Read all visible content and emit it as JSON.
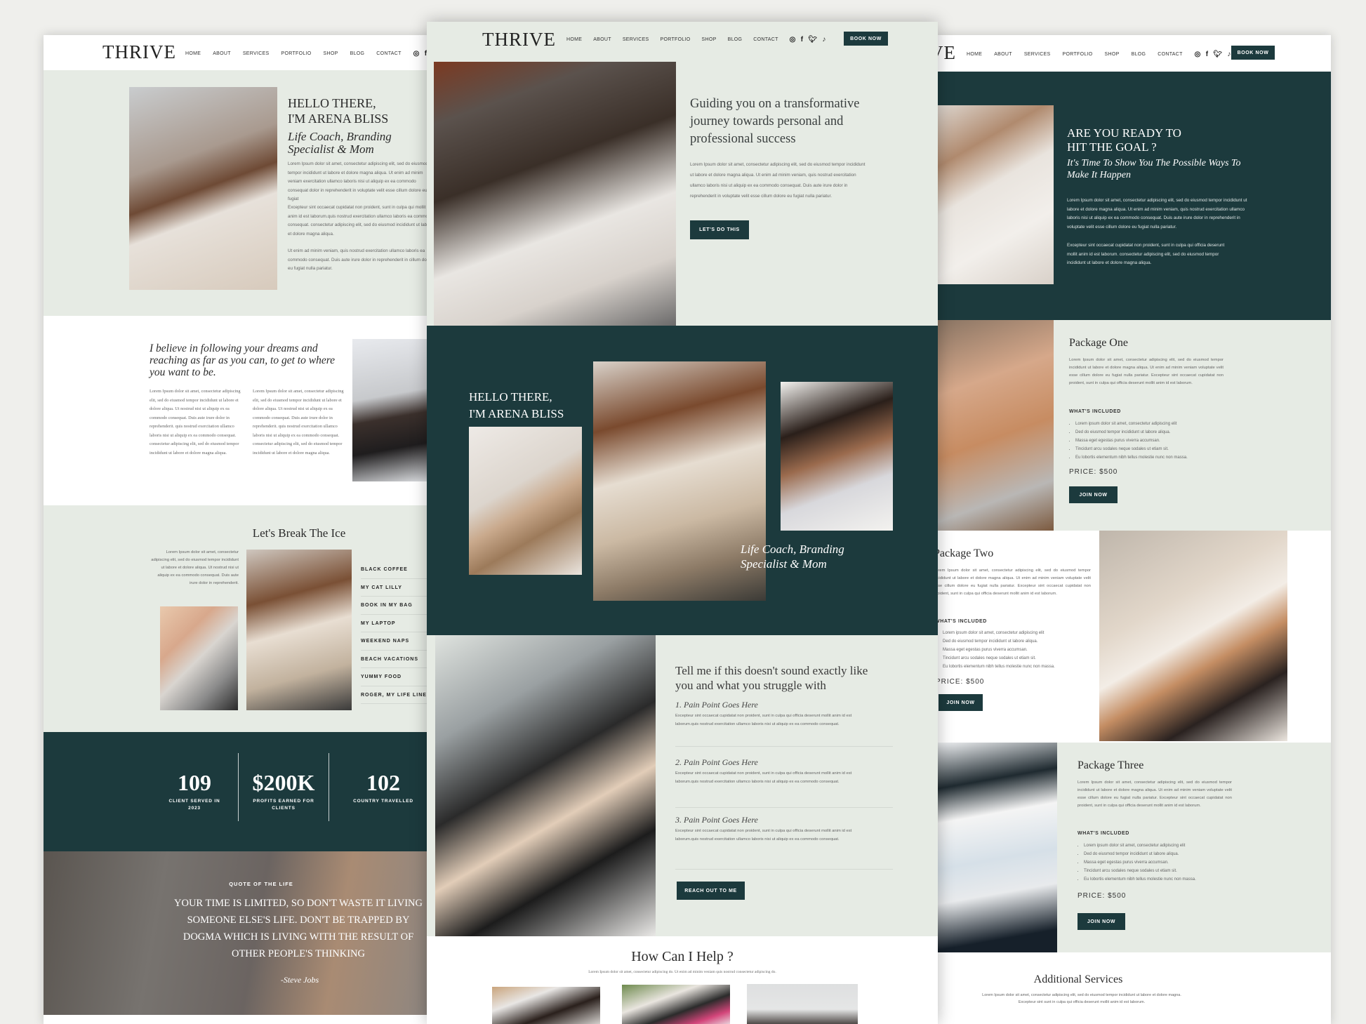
{
  "brand": {
    "logo": "THRIVE",
    "accent": "#1c3a3d",
    "sage": "#e6ebe4"
  },
  "nav": {
    "items": [
      "HOME",
      "ABOUT",
      "SERVICES",
      "PORTFOLIO",
      "SHOP",
      "BLOG",
      "CONTACT"
    ],
    "book_now": "BOOK NOW",
    "icons": [
      "instagram-icon",
      "facebook-icon",
      "twitter-icon",
      "tiktok-icon"
    ]
  },
  "left": {
    "hero": {
      "title1": "HELLO THERE,",
      "title2": "I'M ARENA BLISS",
      "subtitle": "Life Coach, Branding Specialist & Mom",
      "p1": "Lorem Ipsum dolor sit amet, consectetur adipiscing elit, sed do eiusmod tempor incididunt ut labore et dolore magna aliqua. Ut enim ad minim veniam exercitation ullamco laboris nisi ut aliquip ex ea commodo consequat dolor in reprehenderit in voluptate velit esse cillum dolore eu fugiat",
      "p2": "Excepteur sint occaecat cupidatat non proident, sunt in culpa qui mollit anim id est laborum.quis nostrud exercitation ullamco laboris ea commodo consequat. consectetur adipiscing elit, sed do eiusmod incididunt ut labore et dolore magna aliqua.",
      "p3": "Ut enim ad minim veniam, quis nostrud exercitation ullamco laboris ea commodo consequat. Duis aute irure dolor in reprehenderit in cillum dolore eu fugiat nulla pariatur."
    },
    "belief": {
      "quote": "I believe in following your dreams and reaching as far as you can, to get to where you want to be.",
      "col1": "Lorem Ipsum dolor sit amet, consectetur adipiscing elit, sed do eiusmod tempor incididunt ut labore et dolore aliqua. Ut nostrud nisi ut aliquip ex ea commodo consequat. Duis aute irure dolor in reprehenderit. quis nostrud exercitation ullamco laboris nisi ut aliquip ex ea commodo consequat. consectetur adipiscing elit, sed do eiusmod tempor incididunt ut labore et dolore magna aliqua.",
      "col2": "Lorem Ipsum dolor sit amet, consectetur adipiscing elit, sed do eiusmod tempor incididunt ut labore et dolore aliqua. Ut nostrud nisi ut aliquip ex ea commodo consequat. Duis aute irure dolor in reprehenderit. quis nostrud exercitation ullamco laboris nisi ut aliquip ex ea commodo consequat. consectetur adipiscing elit, sed do eiusmod tempor incididunt ut labore et dolore magna aliqua."
    },
    "ice": {
      "title": "Let's Break The Ice",
      "text": "Lorem Ipsum dolor sit amet, consectetur adipiscing elit, sed do eiusmod tempor incididunt ut labore et dolore aliqua. Ut nostrud nisi ut aliquip ex ea commodo consequat. Duis aute irure dolor in reprehenderit.",
      "items": [
        "BLACK COFFEE",
        "MY CAT LILLY",
        "BOOK IN MY BAG",
        "MY LAPTOP",
        "WEEKEND NAPS",
        "BEACH VACATIONS",
        "YUMMY FOOD",
        "ROGER, MY LIFE LINE"
      ]
    },
    "stats": [
      {
        "value": "109",
        "label": "CLIENT SERVED IN 2023"
      },
      {
        "value": "$200K",
        "label": "PROFITS EARNED FOR CLIENTS"
      },
      {
        "value": "102",
        "label": "COUNTRY TRAVELLED"
      }
    ],
    "quote": {
      "kicker": "QUOTE OF THE LIFE",
      "text": "YOUR TIME IS LIMITED, SO DON'T WASTE IT LIVING SOMEONE ELSE'S LIFE. DON'T BE TRAPPED BY DOGMA WHICH IS LIVING WITH THE RESULT OF OTHER PEOPLE'S THINKING",
      "author": "-Steve Jobs"
    }
  },
  "middle": {
    "hero": {
      "title": "Guiding you on a transformative journey towards personal and professional success",
      "text": "Lorem Ipsum dolor sit amet, consectetur adipiscing elit, sed do eiusmod tempor incididunt ut labore et dolore magna aliqua. Ut enim ad minim veniam, quis nostrud exercitation ullamco laboris nisi ut aliquip ex ea commodo consequat. Duis aute irure dolor in reprehenderit in voluptate velit esse cillum dolore eu fugiat nulla pariatur.",
      "button": "LET'S DO THIS"
    },
    "intro": {
      "title1": "HELLO THERE,",
      "title2": "I'M ARENA BLISS",
      "subtitle": "Life Coach, Branding Specialist & Mom"
    },
    "pain": {
      "title": "Tell me if this doesn't sound exactly like you and what you struggle with",
      "items": [
        {
          "title": "1. Pain Point Goes Here",
          "text": "Excepteur sint occaecat cupidatat non proident, sunt in culpa qui officia deserunt mollit anim id est laborum.quis nostrud exercitation ullamco laboris nisi ut aliquip ex ea commodo consequat."
        },
        {
          "title": "2. Pain Point Goes Here",
          "text": "Excepteur sint occaecat cupidatat non proident, sunt in culpa qui officia deserunt mollit anim id est laborum.quis nostrud exercitation ullamco laboris nisi ut aliquip ex ea commodo consequat."
        },
        {
          "title": "3. Pain Point Goes Here",
          "text": "Excepteur sint occaecat cupidatat non proident, sunt in culpa qui officia deserunt mollit anim id est laborum.quis nostrud exercitation ullamco laboris nisi ut aliquip ex ea commodo consequat."
        }
      ],
      "button": "REACH OUT TO ME"
    },
    "help": {
      "title": "How Can I Help ?",
      "text": "Lorem Ipsum dolor sit amet, consectetur adipiscing do. Ut enim ad minim veniam quis nostrud consectetur adipiscing do."
    }
  },
  "right": {
    "goal": {
      "title1": "ARE YOU READY TO",
      "title2": "HIT THE GOAL ?",
      "subtitle": "It's Time To Show You The Possible Ways To Make It Happen",
      "p1": "Lorem Ipsum dolor sit amet, consectetur adipiscing elit, sed do eiusmod tempor incididunt ut labore et dolore magna aliqua. Ut enim ad minim veniam, quis nostrud exercitation ullamco laboris nisi ut aliquip ex ea commodo consequat. Duis aute irure dolor in reprehenderit in voluptate velit esse cillum dolore eu fugiat nulla pariatur.",
      "p2": "Excepteur sint occaecat cupidatat non proident, sunt in culpa qui officia deserunt mollit anim id est laborum. consectetur adipiscing elit, sed do eiusmod tempor incididunt ut labore et dolore magna aliqua."
    },
    "package_text": "Lorem Ipsum dolor sit amet, consectetur adipiscing elit, sed do eiusmod tempor incididunt ut labore et dolore magna aliqua. Ut enim ad minim veniam voluptate velit esse cillum dolore eu fugiat nulla pariatur. Excepteur sint occaecat cupidatat non proident, sunt in culpa qui officia deserunt mollit anim id est laborum.",
    "included_label": "WHAT'S INCLUDED",
    "bullets": [
      "Lorem ipsum dolor sit amet, consectetur adipiscing elit",
      "Ded do eiusmod tempor incididunt ut labore aliqua.",
      "Massa eget egestas purus viverra accumsan.",
      "Tincidunt arcu sodales neque sodales ut etiam sit.",
      "Eu lobortis elementum nibh tellus molestie nunc non massa."
    ],
    "packages": [
      {
        "title": "Package One",
        "price": "PRICE:  $500",
        "button": "JOIN NOW"
      },
      {
        "title": "Package Two",
        "price": "PRICE:  $500",
        "button": "JOIN NOW"
      },
      {
        "title": "Package Three",
        "price": "PRICE:  $500",
        "button": "JOIN NOW"
      }
    ],
    "additional": {
      "title": "Additional Services",
      "text": "Lorem Ipsum dolor sit amet, consectetur adipiscing elit, sed do eiusmod tempor incididunt ut labore et dolore magna. Excepteur sint sunt in culpa qui officia deserunt mollit anim id est laborum."
    }
  }
}
